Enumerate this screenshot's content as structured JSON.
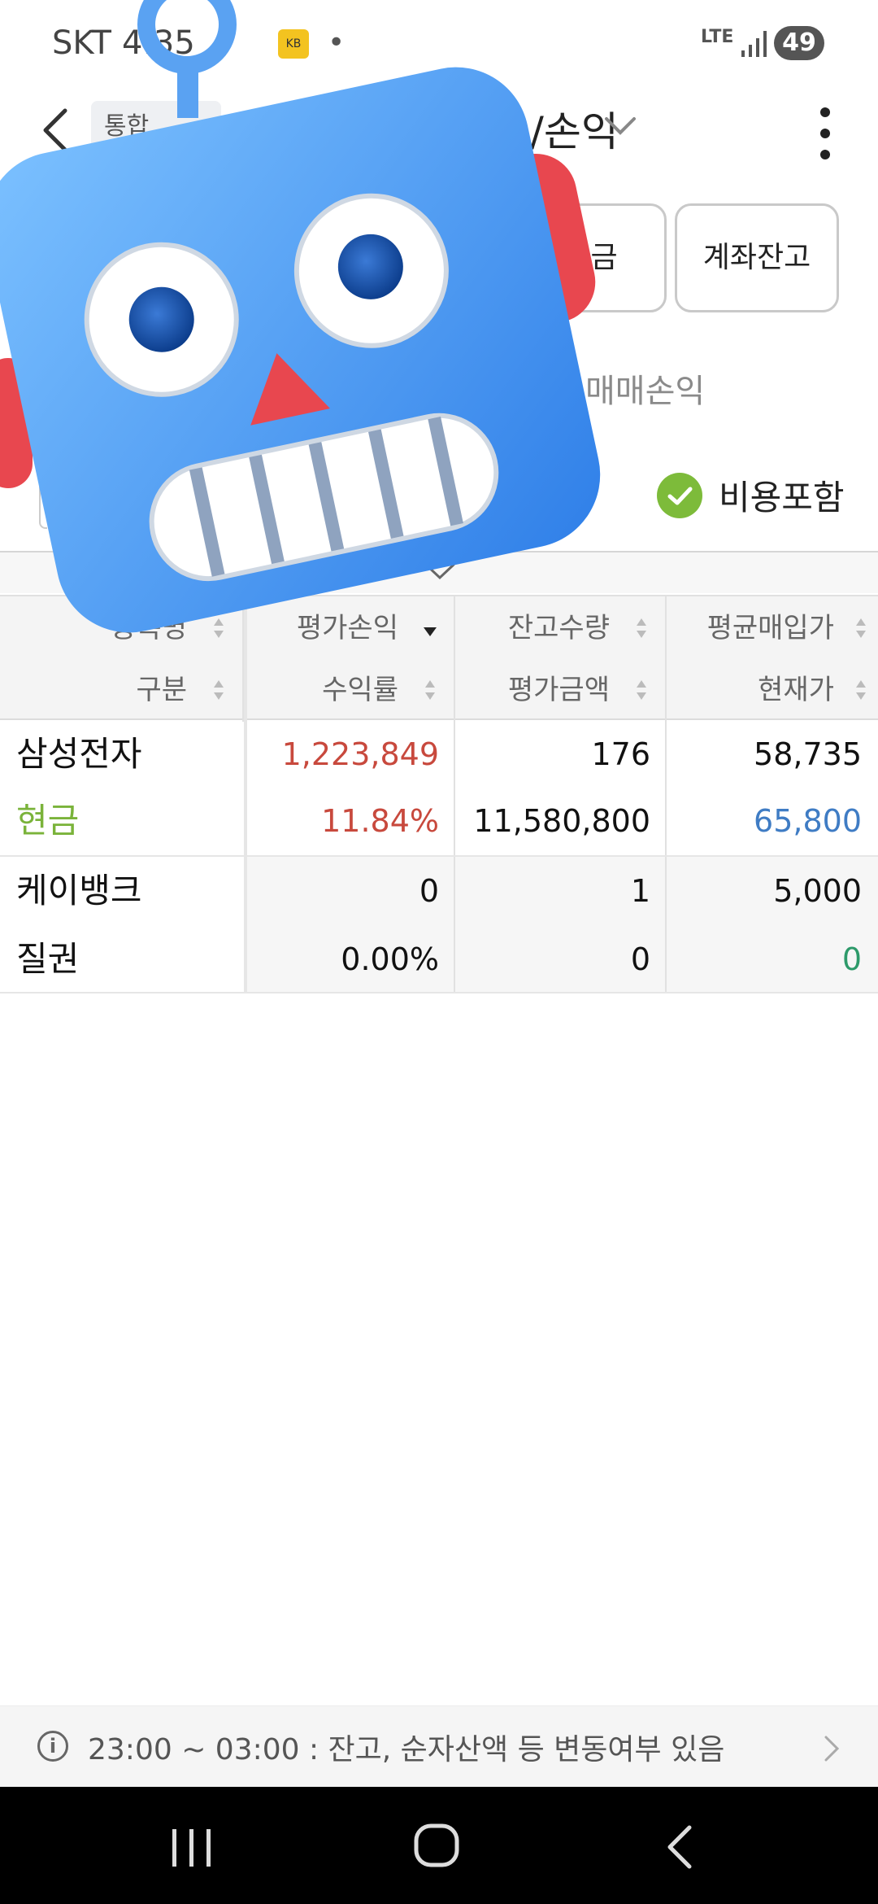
{
  "status_bar": {
    "carrier": "SKT",
    "time": "4:35",
    "network": "LTE",
    "battery": "49"
  },
  "header": {
    "account_chip": "통합",
    "title": "잔고/손익",
    "more": "more"
  },
  "actions": {
    "deposit": "입출금",
    "balance": "계좌잔고"
  },
  "tabs": {
    "trade_pl": "매매손익"
  },
  "cost_toggle": {
    "label": "비용포함",
    "checked": true,
    "color": "#7dbb3a"
  },
  "table": {
    "headers_row1": [
      "종목명",
      "평가손익",
      "잔고수량",
      "평균매입가"
    ],
    "headers_row2": [
      "구분",
      "수익률",
      "평가금액",
      "현재가"
    ],
    "rows": [
      {
        "name": "삼성전자",
        "type": "현금",
        "pl": "1,223,849",
        "rate": "11.84%",
        "qty": "176",
        "eval": "11,580,800",
        "avg": "58,735",
        "price": "65,800"
      },
      {
        "name": "케이뱅크",
        "type": "질권",
        "pl": "0",
        "rate": "0.00%",
        "qty": "1",
        "eval": "0",
        "avg": "5,000",
        "price": "0"
      }
    ]
  },
  "notice": {
    "text": "23:00 ~ 03:00 : 잔고, 순자산액 등 변동여부 있음"
  },
  "colors": {
    "profit": "#c8493d",
    "price_down": "#3f7cc4",
    "cash": "#7ab33a",
    "zero": "#2d9a6a"
  }
}
